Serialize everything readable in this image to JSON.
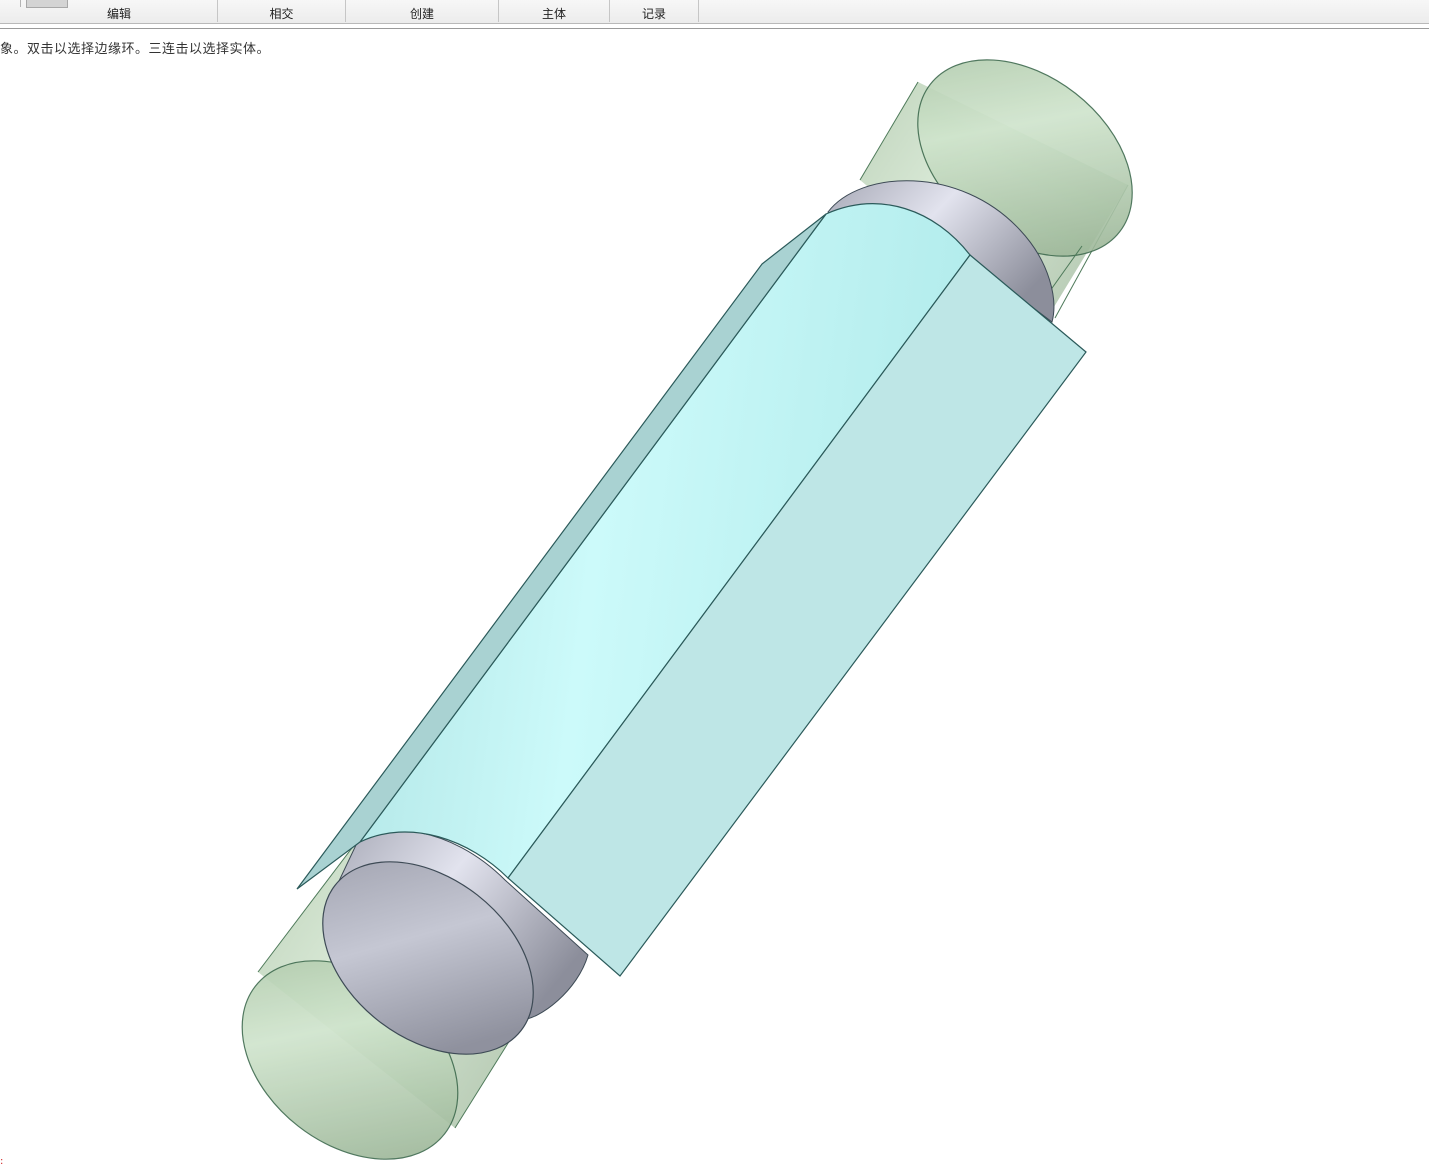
{
  "ribbon": {
    "groups": [
      {
        "label": "编辑"
      },
      {
        "label": "相交"
      },
      {
        "label": "创建"
      },
      {
        "label": "主体"
      },
      {
        "label": "记录"
      }
    ]
  },
  "status_hint": "象。双击以选择边缘环。三连击以选择实体。",
  "viewport": {
    "colors": {
      "background": "#ffffff",
      "cylinder_transparent": "#b9d3b0",
      "ring_face": "#c9cad6",
      "end_cap": "#aeb0bc",
      "surface": "#c8f4f4",
      "side_face": "#bde5e5",
      "edge": "#2b5a5a"
    }
  }
}
